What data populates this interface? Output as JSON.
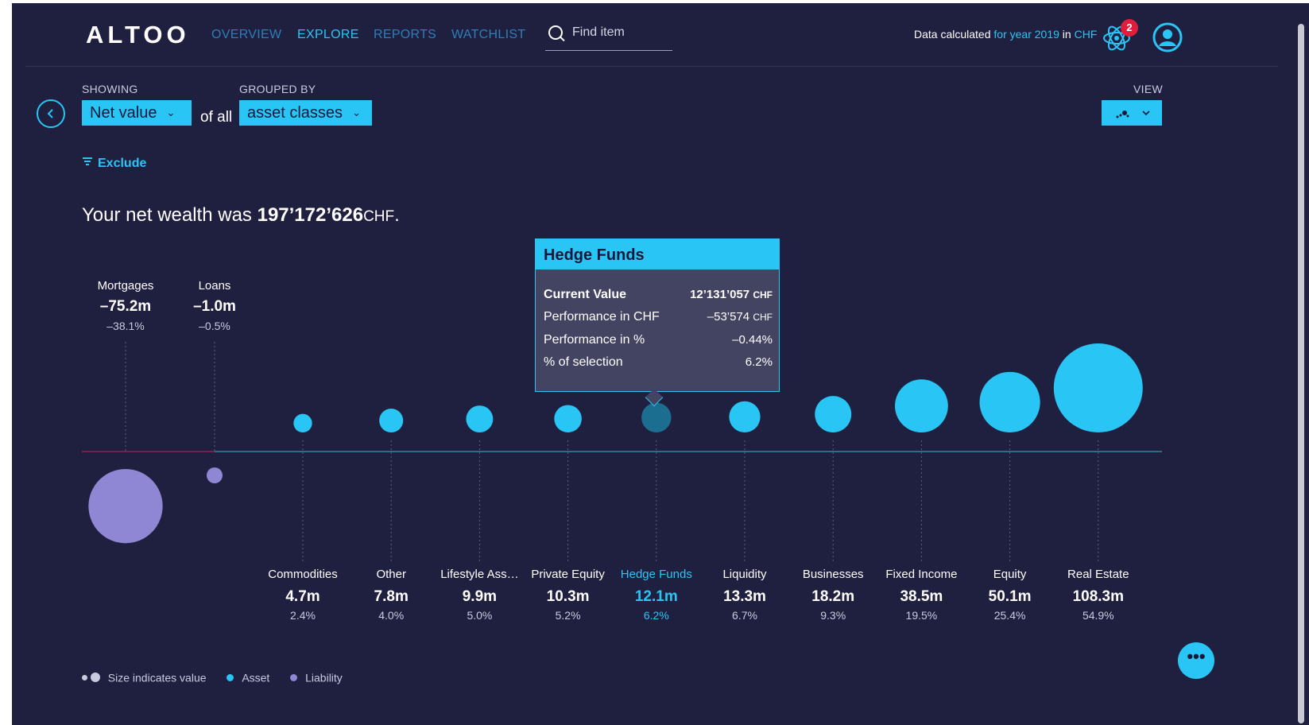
{
  "app": {
    "logo": "ALTOO"
  },
  "nav": {
    "items": [
      {
        "label": "OVERVIEW",
        "active": false
      },
      {
        "label": "EXPLORE",
        "active": true
      },
      {
        "label": "REPORTS",
        "active": false
      },
      {
        "label": "WATCHLIST",
        "active": false
      }
    ]
  },
  "search": {
    "placeholder": "Find item",
    "value": ""
  },
  "data_info": {
    "prefix": "Data calculated",
    "year": "for year 2019",
    "in": "in",
    "currency": "CHF"
  },
  "notifications": {
    "count": "2"
  },
  "controls": {
    "showing_label": "SHOWING",
    "showing_value": "Net value",
    "of_all": "of all",
    "grouped_label": "GROUPED BY",
    "grouped_value": "asset classes",
    "view_label": "VIEW"
  },
  "exclude_label": "Exclude",
  "summary": {
    "prefix": "Your net wealth was",
    "value": "197’172’626",
    "currency": "CHF",
    "suffix": "."
  },
  "tooltip": {
    "title": "Hedge Funds",
    "rows": [
      {
        "key": "Current Value",
        "value": "12’131’057",
        "currency": "CHF"
      },
      {
        "key": "Performance in CHF",
        "value": "–53’574",
        "currency": "CHF"
      },
      {
        "key": "Performance in %",
        "value": "–0.44%",
        "currency": ""
      },
      {
        "key": "% of selection",
        "value": "6.2%",
        "currency": ""
      }
    ]
  },
  "colors": {
    "background": "#1f1f3f",
    "asset": "#29c6f5",
    "liability": "#8f86d4",
    "selected": "#1c6e90",
    "negative_line": "#c8245a",
    "positive_line": "#3fd0d8"
  },
  "chart_data": {
    "type": "scatter",
    "encoding": "bubble size indicates value",
    "liabilities": [
      {
        "name": "Mortgages",
        "value_label": "–75.2m",
        "value": -75.2,
        "pct": "–38.1%"
      },
      {
        "name": "Loans",
        "value_label": "–1.0m",
        "value": -1.0,
        "pct": "–0.5%"
      }
    ],
    "assets": [
      {
        "name": "Commodities",
        "value_label": "4.7m",
        "value": 4.7,
        "pct": "2.4%"
      },
      {
        "name": "Other",
        "value_label": "7.8m",
        "value": 7.8,
        "pct": "4.0%"
      },
      {
        "name": "Lifestyle Ass…",
        "value_label": "9.9m",
        "value": 9.9,
        "pct": "5.0%"
      },
      {
        "name": "Private Equity",
        "value_label": "10.3m",
        "value": 10.3,
        "pct": "5.2%"
      },
      {
        "name": "Hedge Funds",
        "value_label": "12.1m",
        "value": 12.1,
        "pct": "6.2%",
        "selected": true
      },
      {
        "name": "Liquidity",
        "value_label": "13.3m",
        "value": 13.3,
        "pct": "6.7%"
      },
      {
        "name": "Businesses",
        "value_label": "18.2m",
        "value": 18.2,
        "pct": "9.3%"
      },
      {
        "name": "Fixed Income",
        "value_label": "38.5m",
        "value": 38.5,
        "pct": "19.5%"
      },
      {
        "name": "Equity",
        "value_label": "50.1m",
        "value": 50.1,
        "pct": "25.4%"
      },
      {
        "name": "Real Estate",
        "value_label": "108.3m",
        "value": 108.3,
        "pct": "54.9%"
      }
    ]
  },
  "legend": {
    "size": "Size indicates value",
    "asset": "Asset",
    "liability": "Liability"
  }
}
